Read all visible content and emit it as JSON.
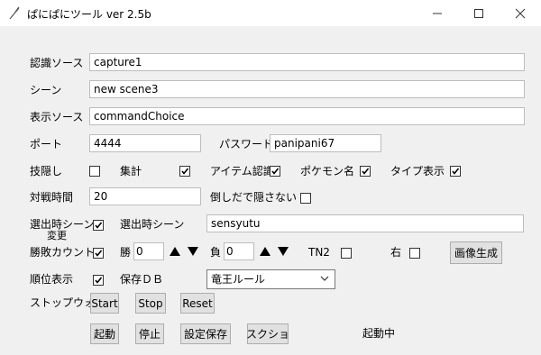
{
  "window": {
    "title": "ぱにぱにツール ver 2.5b"
  },
  "fields": {
    "source_label": "認識ソース",
    "source_value": "capture1",
    "scene_label": "シーン",
    "scene_value": "new scene3",
    "display_source_label": "表示ソース",
    "display_source_value": "commandChoice",
    "port_label": "ポート",
    "port_value": "4444",
    "password_label": "パスワード",
    "password_value": "panipani67"
  },
  "options_row": {
    "skill_hide": {
      "label": "技隠し",
      "checked": false
    },
    "tally": {
      "label": "集計",
      "checked": true
    },
    "item_recognition": {
      "label": "アイテム認識",
      "checked": true
    },
    "pokemon_name": {
      "label": "ポケモン名",
      "checked": true
    },
    "type_display": {
      "label": "タイプ表示",
      "checked": true
    }
  },
  "battle_time": {
    "label": "対戦時間",
    "value": "20",
    "no_hide_label": "倒しだで隠さない",
    "no_hide_checked": false
  },
  "selection_scene": {
    "label_line1": "選出時シーン",
    "label_line2": "変更",
    "checked": true,
    "scene_label": "選出時シーン",
    "scene_value": "sensyutu"
  },
  "win_loss": {
    "label": "勝敗カウント",
    "checked": true,
    "win_label": "勝",
    "win_value": "0",
    "loss_label": "負",
    "loss_value": "0",
    "tn2_label": "TN2",
    "tn2_checked": false,
    "right_label": "右",
    "right_checked": false,
    "generate_image_label": "画像生成"
  },
  "ranking": {
    "label": "順位表示",
    "checked": true,
    "save_db_label": "保存ＤＢ",
    "save_db_selected": "竜王ルール"
  },
  "stopwatch": {
    "label": "ストップウォッチ",
    "start": "Start",
    "stop": "Stop",
    "reset": "Reset"
  },
  "actions": {
    "launch": "起動",
    "stop": "停止",
    "save_settings": "設定保存",
    "screenshot": "スクショ"
  },
  "status": {
    "text": "起動中"
  }
}
